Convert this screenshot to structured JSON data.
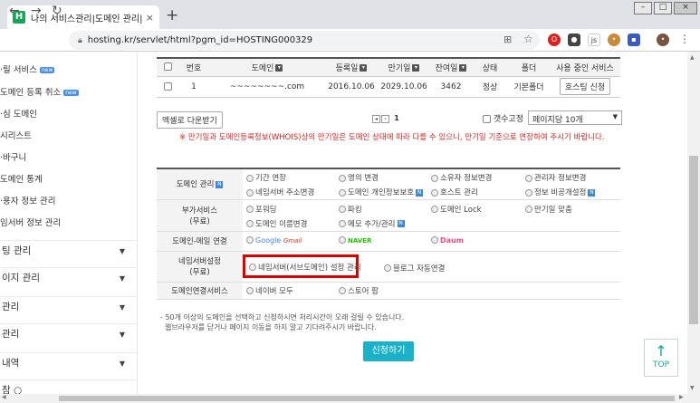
{
  "browser": {
    "tab_title": "나의 서비스관리|도메인 관리|보",
    "favicon_letter": "H",
    "new_tab": "+",
    "close": "×",
    "url": "hosting.kr/servlet/html?pgm_id=HOSTING000329"
  },
  "sidebar": {
    "items": [
      {
        "label": "·릴 서비스",
        "badge": "new"
      },
      {
        "label": "도메인 등록 취소",
        "badge": "new"
      },
      {
        "label": "·심 도메인"
      },
      {
        "label": "시리스트"
      },
      {
        "label": "·바구니"
      },
      {
        "label": "도메인 통계"
      },
      {
        "label": "·용자 정보 관리"
      },
      {
        "label": "임서버 정보 관리"
      }
    ],
    "sections": [
      "팅 관리",
      "이지 관리",
      "관리",
      "관리",
      "내역",
      "참 ○"
    ]
  },
  "domain_table": {
    "headers": [
      "번호",
      "도메인",
      "등록일",
      "만기일",
      "잔여일",
      "상태",
      "폴더",
      "사용 중인 서비스"
    ],
    "rows": [
      {
        "no": "1",
        "domain": "~~~~~~~~.com",
        "registered": "2016.10.06",
        "expiry": "2029.10.06",
        "remaining": "3462",
        "status": "정상",
        "folder": "기본폴더",
        "service": "호스팅 신청"
      }
    ]
  },
  "list_controls": {
    "excel_button": "엑셀로 다운받기",
    "current_page": "1",
    "count_fixed_label": "갯수고정",
    "per_page": "페이지당 10개"
  },
  "notice": "※ 만기일과 도메인등록정보(WHOIS)상의 만기일은 도메인 상태에 따라 다를 수 있으니, 만기일 기준으로 연장하여 주시기 바랍니다.",
  "service_table": {
    "rows": [
      {
        "label": "도메인 관리",
        "badge": "N",
        "options": [
          {
            "text": "기간 연장"
          },
          {
            "text": "명의 변경"
          },
          {
            "text": "소유자 정보변경"
          },
          {
            "text": "관리자 정보변경"
          },
          {
            "text": "네임서버 주소변경"
          },
          {
            "text": "도메인 개인정보보호",
            "badge": "N"
          },
          {
            "text": "호스트 관리"
          },
          {
            "text": "정보 비공개설정",
            "badge": "N"
          }
        ]
      },
      {
        "label": "부가서비스",
        "label2": "(무료)",
        "options": [
          {
            "text": "포워딩"
          },
          {
            "text": "파킹"
          },
          {
            "text": "도메인 Lock"
          },
          {
            "text": "만기일 맞춤"
          },
          {
            "text": "도메인 이름변경"
          },
          {
            "text": "메모 추가/관리",
            "badge": "N"
          }
        ]
      },
      {
        "label": "도메인-메일 연결",
        "logos": [
          "Google",
          "Gmail",
          "NAVER",
          "Daum"
        ]
      },
      {
        "label": "네임서버설정",
        "label2": "(무료)",
        "options": [
          {
            "text": "네임서버(서브도메인) 설정 관리"
          },
          {
            "text": "블로그 자동연결"
          }
        ]
      },
      {
        "label": "도메인연결서비스",
        "options": [
          {
            "text": "네이버 모두"
          },
          {
            "text": "스토어 팜"
          }
        ]
      }
    ]
  },
  "footnote": {
    "line1": "50개 이상의 도메인을 선택하고 신청하시면 처리시간이 오래 걸릴 수 있습니다.",
    "line2": "웹브라우저를 닫거나 페이지 이동을 하지 말고 기다려주시기 바랍니다."
  },
  "apply_button": "신청하기",
  "top_button": "TOP",
  "colors": {
    "accent": "#1ab2c8",
    "highlight": "#e00000",
    "brand": "#1ca35a",
    "notice": "#e02020"
  }
}
